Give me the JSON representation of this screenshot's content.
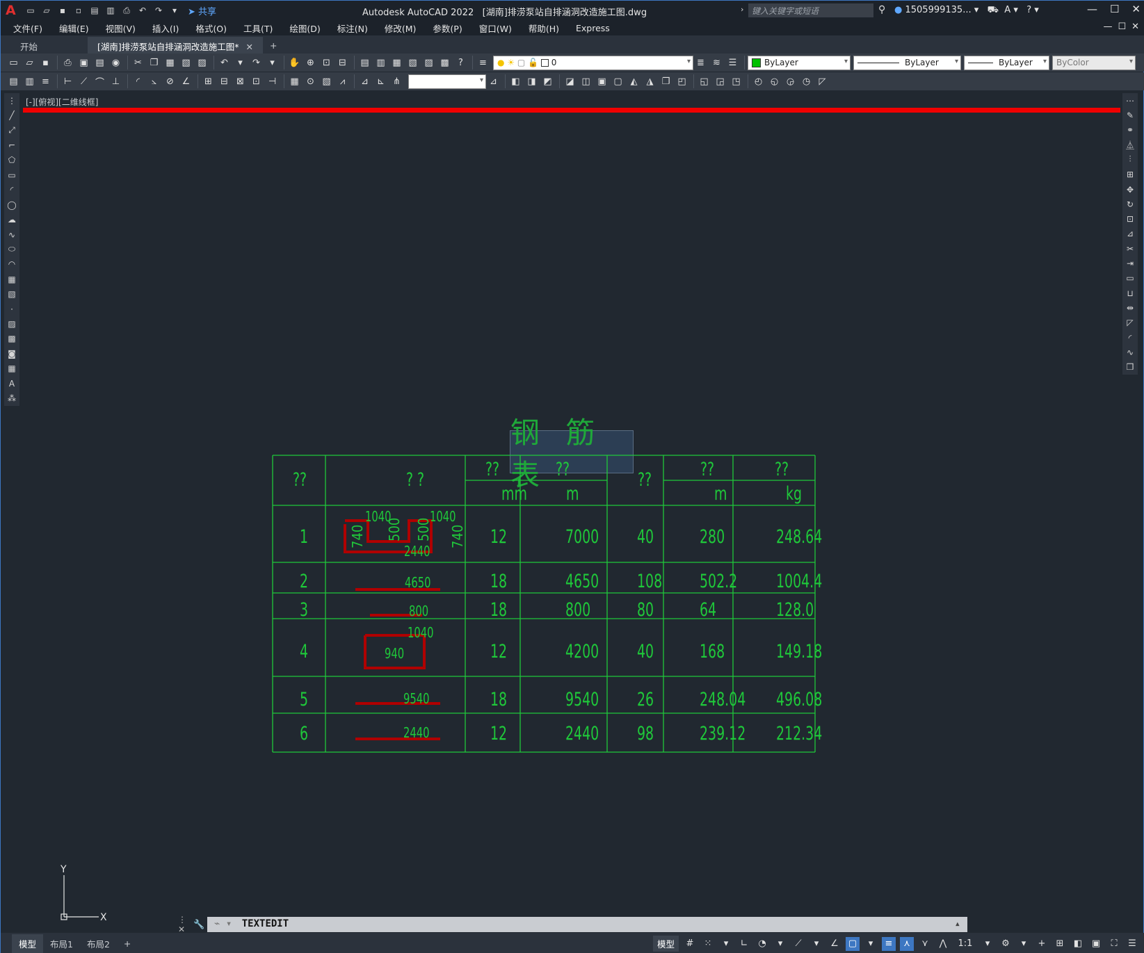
{
  "window": {
    "app_title": "Autodesk AutoCAD 2022",
    "file_title": "[湖南]排涝泵站自排涵洞改造施工图.dwg",
    "logo": "A",
    "share_label": "共享",
    "search_placeholder": "键入关键字或短语",
    "user": "1505999135...",
    "minimize": "—",
    "maximize": "☐",
    "close": "✕"
  },
  "menu": [
    "文件(F)",
    "编辑(E)",
    "视图(V)",
    "插入(I)",
    "格式(O)",
    "工具(T)",
    "绘图(D)",
    "标注(N)",
    "修改(M)",
    "参数(P)",
    "窗口(W)",
    "帮助(H)",
    "Express"
  ],
  "tabs": {
    "start": "开始",
    "active": "[湖南]排涝泵站自排涵洞改造施工图*",
    "close": "✕",
    "add": "+"
  },
  "properties": {
    "layer": "0",
    "color": "ByLayer",
    "color_hex": "#00c000",
    "linetype": "ByLayer",
    "lineweight": "ByLayer",
    "plotstyle": "ByColor",
    "style_combo": ""
  },
  "viewport": {
    "label": "[-][俯视][二维线框]",
    "accent_line": "#f00000"
  },
  "drawing": {
    "title": "钢 筋 表",
    "header": {
      "c1": "??",
      "c2": "?  ?",
      "c3": "??",
      "c3_unit": "mm",
      "c4": "??",
      "c4_unit": "m",
      "c5": "??",
      "c6": "??",
      "c6_unit": "m",
      "c7": "??",
      "c7_unit": "kg"
    },
    "rows": [
      {
        "no": "1",
        "diameter": "12",
        "length": "7000",
        "count": "40",
        "total": "280",
        "weight": "248.64"
      },
      {
        "no": "2",
        "diameter": "18",
        "length": "4650",
        "count": "108",
        "total": "502.2",
        "weight": "1004.4"
      },
      {
        "no": "3",
        "diameter": "18",
        "length": "800",
        "count": "80",
        "total": "64",
        "weight": "128.0"
      },
      {
        "no": "4",
        "diameter": "12",
        "length": "4200",
        "count": "40",
        "total": "168",
        "weight": "149.18"
      },
      {
        "no": "5",
        "diameter": "18",
        "length": "9540",
        "count": "26",
        "total": "248.04",
        "weight": "496.08"
      },
      {
        "no": "6",
        "diameter": "12",
        "length": "2440",
        "count": "98",
        "total": "239.12",
        "weight": "212.34"
      }
    ],
    "shape_labels": {
      "r1_top_left": "1040",
      "r1_top_right": "1040",
      "r1_side_left": "740",
      "r1_side_right": "740",
      "r1_inner_left": "500",
      "r1_inner_right": "500",
      "r1_bottom": "2440",
      "r2": "4650",
      "r3": "800",
      "r4_top": "1040",
      "r4_left": "940",
      "r5": "9540",
      "r6": "2440"
    },
    "line_color": "#1fc83a",
    "rebar_color": "#b00000"
  },
  "ucs": {
    "x": "X",
    "y": "Y"
  },
  "command": {
    "text": "TEXTEDIT"
  },
  "status": {
    "layouts": [
      "模型",
      "布局1",
      "布局2"
    ],
    "add": "+",
    "model": "模型",
    "scale": "1:1"
  }
}
